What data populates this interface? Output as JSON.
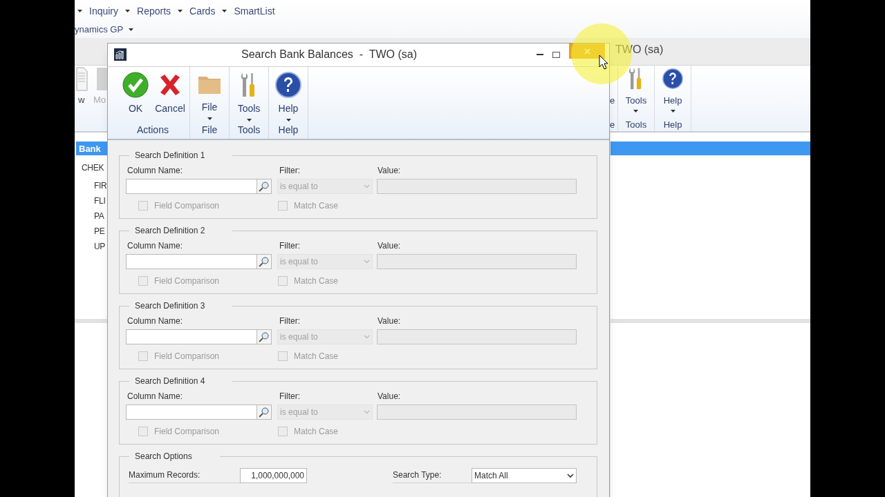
{
  "background_app": {
    "menu": [
      {
        "label": "Inquiry",
        "dropdown": true
      },
      {
        "label": "Reports",
        "dropdown": true
      },
      {
        "label": "Cards",
        "dropdown": true
      },
      {
        "label": "SmartList",
        "dropdown": false
      }
    ],
    "submenu": "ynamics GP",
    "title": "TWO (sa)",
    "ribbon_left": [
      "w",
      "Mo"
    ],
    "ribbon_right": [
      {
        "label": "e",
        "group": "e",
        "kind": "partial"
      },
      {
        "label": "Tools",
        "group": "Tools",
        "kind": "tools"
      },
      {
        "label": "Help",
        "group": "Help",
        "kind": "help"
      }
    ],
    "list_header": "Bank",
    "list_items": [
      "CHEK",
      "FIR",
      "FLI",
      "PA",
      "PE",
      "UP"
    ]
  },
  "dialog": {
    "title": "Search Bank Balances  -  TWO (sa)",
    "close_hovered": true,
    "ribbon_groups": [
      {
        "label": "Actions",
        "buttons": [
          {
            "label": "OK",
            "kind": "ok",
            "dropdown": false
          },
          {
            "label": "Cancel",
            "kind": "cancel",
            "dropdown": false
          }
        ]
      },
      {
        "label": "File",
        "buttons": [
          {
            "label": "File",
            "kind": "file",
            "dropdown": true
          }
        ]
      },
      {
        "label": "Tools",
        "buttons": [
          {
            "label": "Tools",
            "kind": "tools",
            "dropdown": true
          }
        ]
      },
      {
        "label": "Help",
        "buttons": [
          {
            "label": "Help",
            "kind": "help",
            "dropdown": true
          }
        ]
      }
    ],
    "search_definitions": [
      {
        "title": "Search Definition 1",
        "column_label": "Column Name:",
        "filter_label": "Filter:",
        "filter_value": "is equal to",
        "value_label": "Value:",
        "field_comparison": "Field Comparison",
        "match_case": "Match Case",
        "field_comparison_checked": false,
        "match_case_checked": false
      },
      {
        "title": "Search Definition 2",
        "column_label": "Column Name:",
        "filter_label": "Filter:",
        "filter_value": "is equal to",
        "value_label": "Value:",
        "field_comparison": "Field Comparison",
        "match_case": "Match Case",
        "field_comparison_checked": false,
        "match_case_checked": false
      },
      {
        "title": "Search Definition 3",
        "column_label": "Column Name:",
        "filter_label": "Filter:",
        "filter_value": "is equal to",
        "value_label": "Value:",
        "field_comparison": "Field Comparison",
        "match_case": "Match Case",
        "field_comparison_checked": false,
        "match_case_checked": false
      },
      {
        "title": "Search Definition 4",
        "column_label": "Column Name:",
        "filter_label": "Filter:",
        "filter_value": "is equal to",
        "value_label": "Value:",
        "field_comparison": "Field Comparison",
        "match_case": "Match Case",
        "field_comparison_checked": false,
        "match_case_checked": false
      }
    ],
    "search_options": {
      "title": "Search Options",
      "max_records_label": "Maximum Records:",
      "max_records": "1,000,000,000",
      "search_type_label": "Search Type:",
      "search_type": "Match All"
    }
  }
}
